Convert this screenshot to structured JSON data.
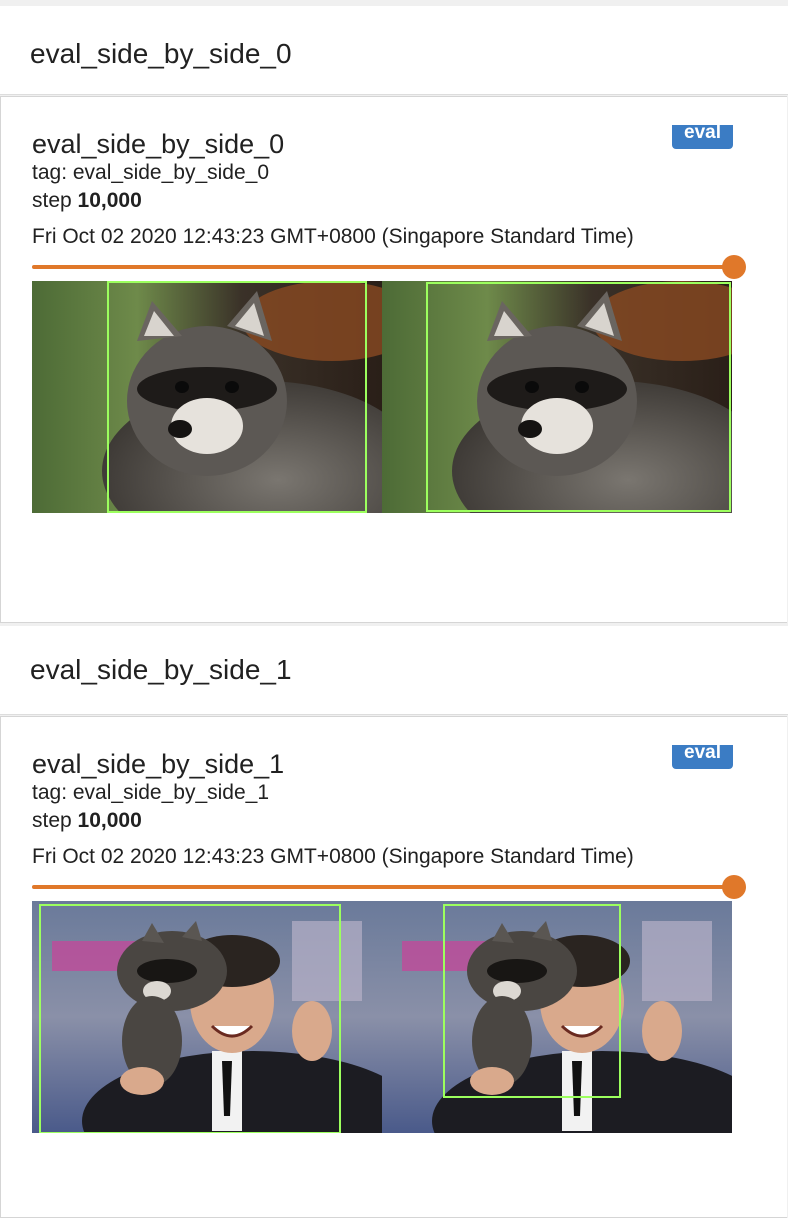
{
  "groups": [
    {
      "header": "eval_side_by_side_0",
      "card": {
        "title": "eval_side_by_side_0",
        "tag": "tag: eval_side_by_side_0",
        "step_label": "step",
        "step_value": "10,000",
        "timestamp": "Fri Oct 02 2020 12:43:23 GMT+0800 (Singapore Standard Time)",
        "badge": "eval",
        "slider_value": 1.0,
        "images": [
          "raccoon-ground-truth",
          "raccoon-prediction"
        ]
      }
    },
    {
      "header": "eval_side_by_side_1",
      "card": {
        "title": "eval_side_by_side_1",
        "tag": "tag: eval_side_by_side_1",
        "step_label": "step",
        "step_value": "10,000",
        "timestamp": "Fri Oct 02 2020 12:43:23 GMT+0800 (Singapore Standard Time)",
        "badge": "eval",
        "slider_value": 1.0,
        "images": [
          "raccoon-man-ground-truth",
          "raccoon-man-prediction"
        ]
      }
    }
  ],
  "colors": {
    "accent": "#e0782a",
    "badge": "#3b7cc4",
    "bbox": "#9cff5e"
  }
}
